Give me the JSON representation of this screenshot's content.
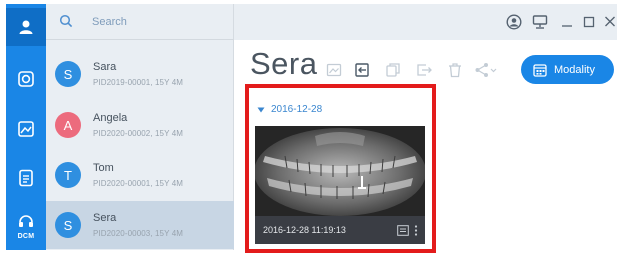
{
  "search": {
    "placeholder": "Search"
  },
  "patients": [
    {
      "initial": "S",
      "name": "Sara",
      "pid": "PID2019-00001, 15Y 4M",
      "avatar_color": "#2f8fe0",
      "selected": false
    },
    {
      "initial": "A",
      "name": "Angela",
      "pid": "PID2020-00002, 15Y 4M",
      "avatar_color": "#ec6b7d",
      "selected": false
    },
    {
      "initial": "T",
      "name": "Tom",
      "pid": "PID2020-00001, 15Y 4M",
      "avatar_color": "#2f8fe0",
      "selected": false
    },
    {
      "initial": "S",
      "name": "Sera",
      "pid": "PID2020-00003, 15Y 4M",
      "avatar_color": "#2f8fe0",
      "selected": true
    }
  ],
  "rail": {
    "dcm_label": "DCM"
  },
  "detail": {
    "patient_name": "Sera",
    "modality_label": "Modality",
    "date_group": "2016-12-28",
    "thumbnail_datetime": "2016-12-28  11:19:13"
  },
  "icons": [
    "user-icon",
    "camera-icon",
    "gallery-icon",
    "document-icon",
    "dcm-icon",
    "search-icon",
    "account-icon",
    "monitor-icon",
    "minimize-icon",
    "maximize-icon",
    "close-icon",
    "image-icon",
    "import-icon",
    "copy-icon",
    "export-icon",
    "trash-icon",
    "share-icon",
    "calendar-icon",
    "report-icon",
    "more-icon"
  ],
  "colors": {
    "accent": "#1a86e6",
    "highlight": "#e31b1b",
    "avatar_pink": "#ec6b7d"
  }
}
